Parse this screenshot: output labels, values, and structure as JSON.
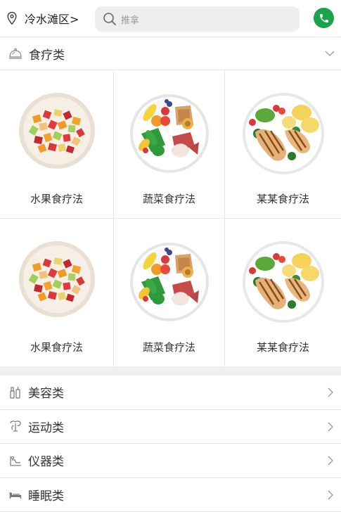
{
  "header": {
    "location": "冷水滩区>",
    "search_placeholder": "推拿"
  },
  "category": {
    "title": "食疗类"
  },
  "grid": {
    "items": [
      {
        "label": "水果食疗法",
        "image": "fruit-bowl"
      },
      {
        "label": "蔬菜食疗法",
        "image": "vegetable-plate"
      },
      {
        "label": "某某食疗法",
        "image": "grilled-chicken-plate"
      },
      {
        "label": "水果食疗法",
        "image": "fruit-bowl"
      },
      {
        "label": "蔬菜食疗法",
        "image": "vegetable-plate"
      },
      {
        "label": "某某食疗法",
        "image": "grilled-chicken-plate"
      }
    ]
  },
  "list": {
    "items": [
      {
        "label": "美容类",
        "icon": "cosmetics-icon"
      },
      {
        "label": "运动类",
        "icon": "exercise-icon"
      },
      {
        "label": "仪器类",
        "icon": "instrument-icon"
      },
      {
        "label": "睡眠类",
        "icon": "bed-icon"
      }
    ]
  },
  "colors": {
    "accent": "#1aa34a",
    "divider": "#f0f0f0"
  }
}
